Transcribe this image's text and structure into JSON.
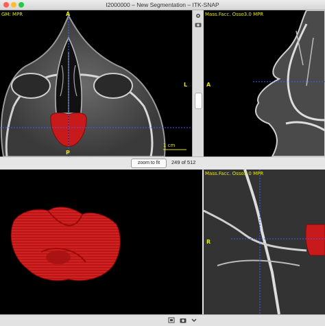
{
  "window": {
    "title": "I2000000 – New Segmentation – ITK-SNAP"
  },
  "axial_view": {
    "orientation": {
      "top": "A",
      "bottom": "P",
      "right": "L"
    },
    "scale_label": "1 cm"
  },
  "sagittal_view": {
    "label": "Mass.Facc. Osso3.0  MPR",
    "orientation": {
      "left": "A"
    }
  },
  "coronal_view": {
    "label": "Mass.Facc. Osso3.0  MPR",
    "orientation": {
      "left": "R"
    }
  },
  "toolbar": {
    "zoom_to_fit_label": "zoom to fit",
    "slice_readout": "249 of 512"
  },
  "top_left_label": "GM: MPR",
  "colors": {
    "segmentation": "#c81a1a",
    "crosshair": "#4060ff",
    "annotation": "#e6e600"
  },
  "icons": [
    "gear-icon",
    "camera-icon",
    "expand-icon",
    "chevron-down-icon"
  ]
}
